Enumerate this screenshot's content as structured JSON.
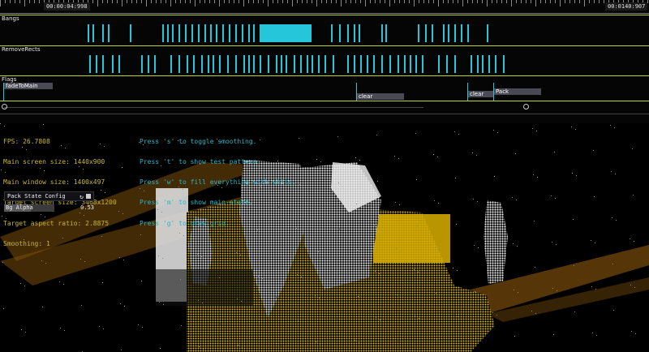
{
  "timeline": {
    "current_time": "00:00:04:998",
    "end_time": "00:0140:907",
    "tracks": {
      "bangs": {
        "label": "Bangs"
      },
      "remove_rects": {
        "label": "RemoveRects"
      },
      "flags": {
        "label": "Flags",
        "markers": [
          "fadeToMain",
          "clear",
          "clear",
          "Pack"
        ]
      }
    }
  },
  "overlay": {
    "stats": [
      "FPS: 26.7808",
      "Main screen size: 1440x900",
      "Main window size: 1400x497",
      "Target screen size: 3468x1200",
      "Target aspect ratio: 2.8875",
      "Smoothing: 1"
    ],
    "help": [
      "Press 's' to toggle smoothing.",
      "Press 't' to show test pattern.",
      "Press 'w' to fill everything with white.",
      "Press 'm' to show main state.",
      "Press 'g' to draw grid."
    ]
  },
  "panel": {
    "title": "Pack State Config",
    "param_label": "Bg Alpha",
    "param_value": "0.53",
    "param_fraction": 0.53
  },
  "colors": {
    "accent": "#26c6da",
    "track_line": "#b8d92a",
    "stats_text": "#c9b72a",
    "help_text": "#26b8c8",
    "scene_yellow": "#e0b400"
  }
}
